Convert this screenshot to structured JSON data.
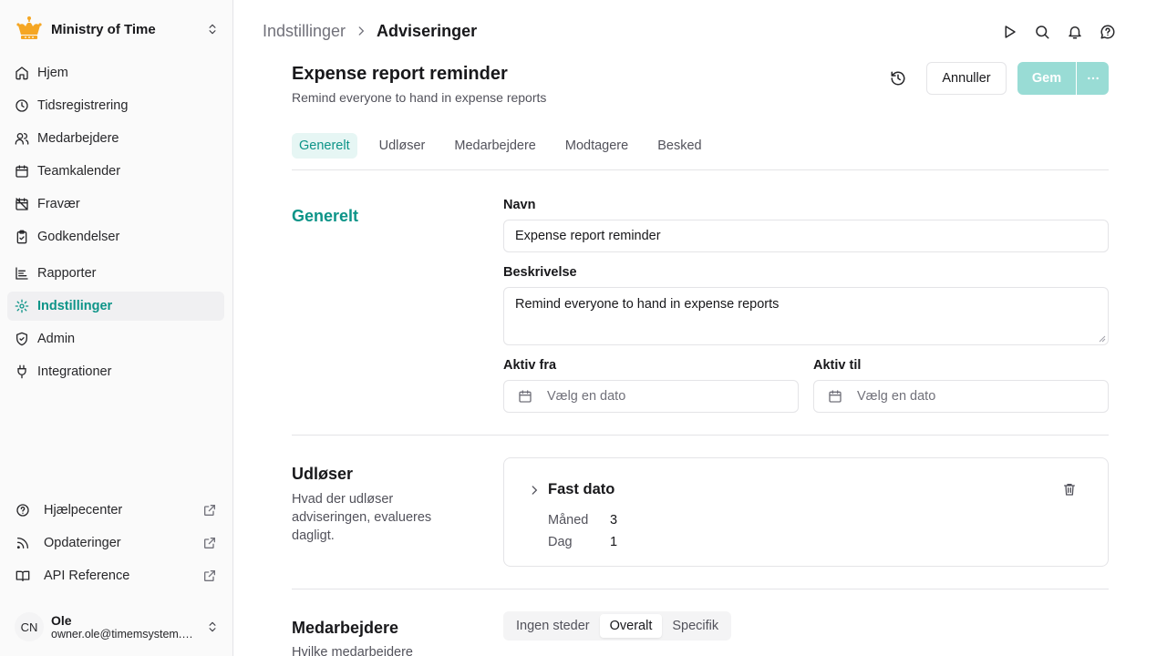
{
  "sidebar": {
    "org_name": "Ministry of Time",
    "nav": [
      {
        "label": "Hjem",
        "icon": "home-icon"
      },
      {
        "label": "Tidsregistrering",
        "icon": "clock-icon"
      },
      {
        "label": "Medarbejdere",
        "icon": "users-icon"
      },
      {
        "label": "Teamkalender",
        "icon": "calendar-icon"
      },
      {
        "label": "Fravær",
        "icon": "calendar-off-icon"
      },
      {
        "label": "Godkendelser",
        "icon": "clipboard-check-icon"
      },
      {
        "label": "Rapporter",
        "icon": "chart-icon"
      },
      {
        "label": "Indstillinger",
        "icon": "gear-icon",
        "active": true
      },
      {
        "label": "Admin",
        "icon": "shield-icon"
      },
      {
        "label": "Integrationer",
        "icon": "plug-icon"
      }
    ],
    "external": [
      {
        "label": "Hjælpecenter",
        "icon": "help-circle-icon"
      },
      {
        "label": "Opdateringer",
        "icon": "rss-icon"
      },
      {
        "label": "API Reference",
        "icon": "book-icon"
      }
    ],
    "user": {
      "initials": "CN",
      "name": "Ole",
      "email": "owner.ole@timemsystem.dk"
    }
  },
  "breadcrumb": {
    "parent": "Indstillinger",
    "current": "Adviseringer"
  },
  "header": {
    "title": "Expense report reminder",
    "subtitle": "Remind everyone to hand in expense reports",
    "cancel_label": "Annuller",
    "save_label": "Gem"
  },
  "tabs": [
    "Generelt",
    "Udløser",
    "Medarbejdere",
    "Modtagere",
    "Besked"
  ],
  "general": {
    "section_title": "Generelt",
    "name_label": "Navn",
    "name_value": "Expense report reminder",
    "desc_label": "Beskrivelse",
    "desc_value": "Remind everyone to hand in expense reports",
    "active_from_label": "Aktiv fra",
    "active_to_label": "Aktiv til",
    "date_placeholder": "Vælg en dato"
  },
  "trigger": {
    "section_title": "Udløser",
    "section_desc": "Hvad der udløser adviseringen, evalueres dagligt.",
    "card_title": "Fast dato",
    "month_label": "Måned",
    "month_value": "3",
    "day_label": "Dag",
    "day_value": "1"
  },
  "employees": {
    "section_title": "Medarbejdere",
    "section_desc": "Hvilke medarbejdere",
    "options": [
      "Ingen steder",
      "Overalt",
      "Specifik"
    ],
    "selected": "Overalt"
  },
  "colors": {
    "accent": "#0d9488",
    "save_disabled": "#99dcd5",
    "crown": "#f5a623"
  }
}
